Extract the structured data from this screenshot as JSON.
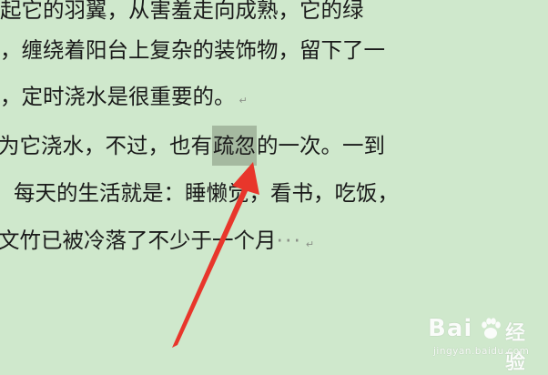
{
  "document": {
    "lines": [
      "起它的羽翼，从害羞走向成熟，它的绿",
      "，缠绕着阳台上复杂的装饰物，留下了一",
      "，定时浇水是很重要的。",
      "为它浇水，不过，也有",
      "每天的生活就是：睡懒觉，看书，吃饭，",
      "文竹已被冷落了不少于一个月"
    ],
    "line4_highlight": "疏忽",
    "line4_after": "的一次。一到",
    "ellipsis": "···",
    "paragraph_mark": "↵"
  },
  "watermark": {
    "brand": "Bai",
    "brand_suffix": "经验",
    "site": "jingyan.baidu.com"
  },
  "colors": {
    "page_background": "#cfe8cc",
    "selection_highlight": "#a5b9a0",
    "annotation_arrow": "#e8362b"
  },
  "icons": [
    "paw-icon",
    "paragraph-mark-icon",
    "red-arrow-icon"
  ]
}
